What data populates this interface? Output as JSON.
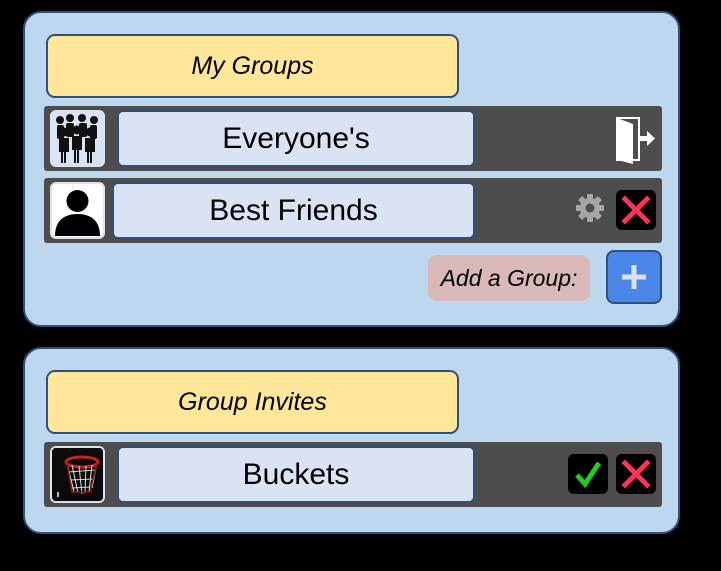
{
  "my_groups": {
    "title": "My Groups",
    "groups": [
      {
        "name": "Everyone's",
        "avatar_icon": "people-group-icon",
        "actions": [
          "leave-group-icon"
        ]
      },
      {
        "name": "Best Friends",
        "avatar_icon": "person-silhouette-icon",
        "actions": [
          "gear-icon",
          "close-icon"
        ]
      }
    ],
    "add_group_label": "Add a Group:",
    "add_icon": "plus-icon"
  },
  "group_invites": {
    "title": "Group Invites",
    "invites": [
      {
        "name": "Buckets",
        "avatar_icon": "basketball-hoop-image",
        "actions": [
          "checkmark-icon",
          "close-icon"
        ]
      }
    ]
  },
  "colors": {
    "page_background": "#000000",
    "panel_background": "#bdd7ee",
    "panel_border": "#2f4f7f",
    "title_background": "#ffe699",
    "row_background": "#4d4d4d",
    "name_background": "#dae3f3",
    "add_label_background": "#d9b8b8",
    "add_button": "#4a86e8",
    "reject_red": "#ff3358",
    "accept_green": "#22cc22"
  }
}
